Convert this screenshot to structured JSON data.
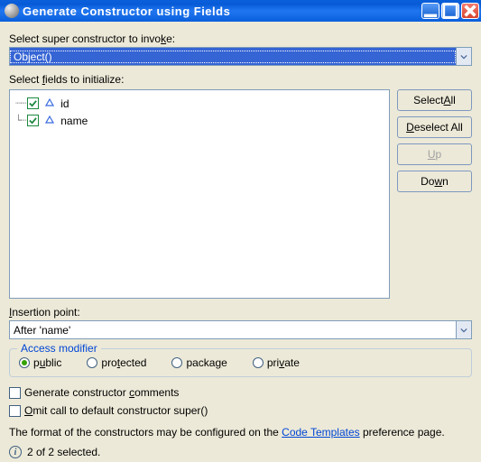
{
  "window": {
    "title": "Generate Constructor using Fields"
  },
  "labels": {
    "super_pre": "Select super constructor to invo",
    "super_u": "k",
    "super_post": "e:",
    "fields_pre": "Select ",
    "fields_u": "f",
    "fields_post": "ields to initialize:",
    "insertion_pre": "",
    "insertion_u": "I",
    "insertion_post": "nsertion point:"
  },
  "super_constructor": {
    "value": "Object()"
  },
  "fields": [
    {
      "name": "id",
      "checked": true
    },
    {
      "name": "name",
      "checked": true
    }
  ],
  "buttons": {
    "select_all_pre": "Select ",
    "select_all_u": "A",
    "select_all_post": "ll",
    "deselect_all_pre": "",
    "deselect_all_u": "D",
    "deselect_all_post": "eselect All",
    "up_pre": "",
    "up_u": "U",
    "up_post": "p",
    "down_pre": "Do",
    "down_u": "w",
    "down_post": "n"
  },
  "insertion": {
    "value": "After 'name'"
  },
  "access": {
    "legend": "Access modifier",
    "public_pre": "p",
    "public_u": "u",
    "public_post": "blic",
    "protected_pre": "pro",
    "protected_u": "t",
    "protected_post": "ected",
    "package_pre": "packa",
    "package_u": "g",
    "package_post": "e",
    "private_pre": "pri",
    "private_u": "v",
    "private_post": "ate",
    "selected": "public"
  },
  "checks": {
    "gen_comments_pre": "Generate constructor ",
    "gen_comments_u": "c",
    "gen_comments_post": "omments",
    "omit_super_pre": "",
    "omit_super_u": "O",
    "omit_super_post": "mit call to default constructor super()"
  },
  "footer": {
    "format_pre": "The format of the constructors may be configured on the ",
    "link": "Code Templates",
    "format_post": " preference page."
  },
  "status": {
    "text": "2 of 2 selected."
  }
}
